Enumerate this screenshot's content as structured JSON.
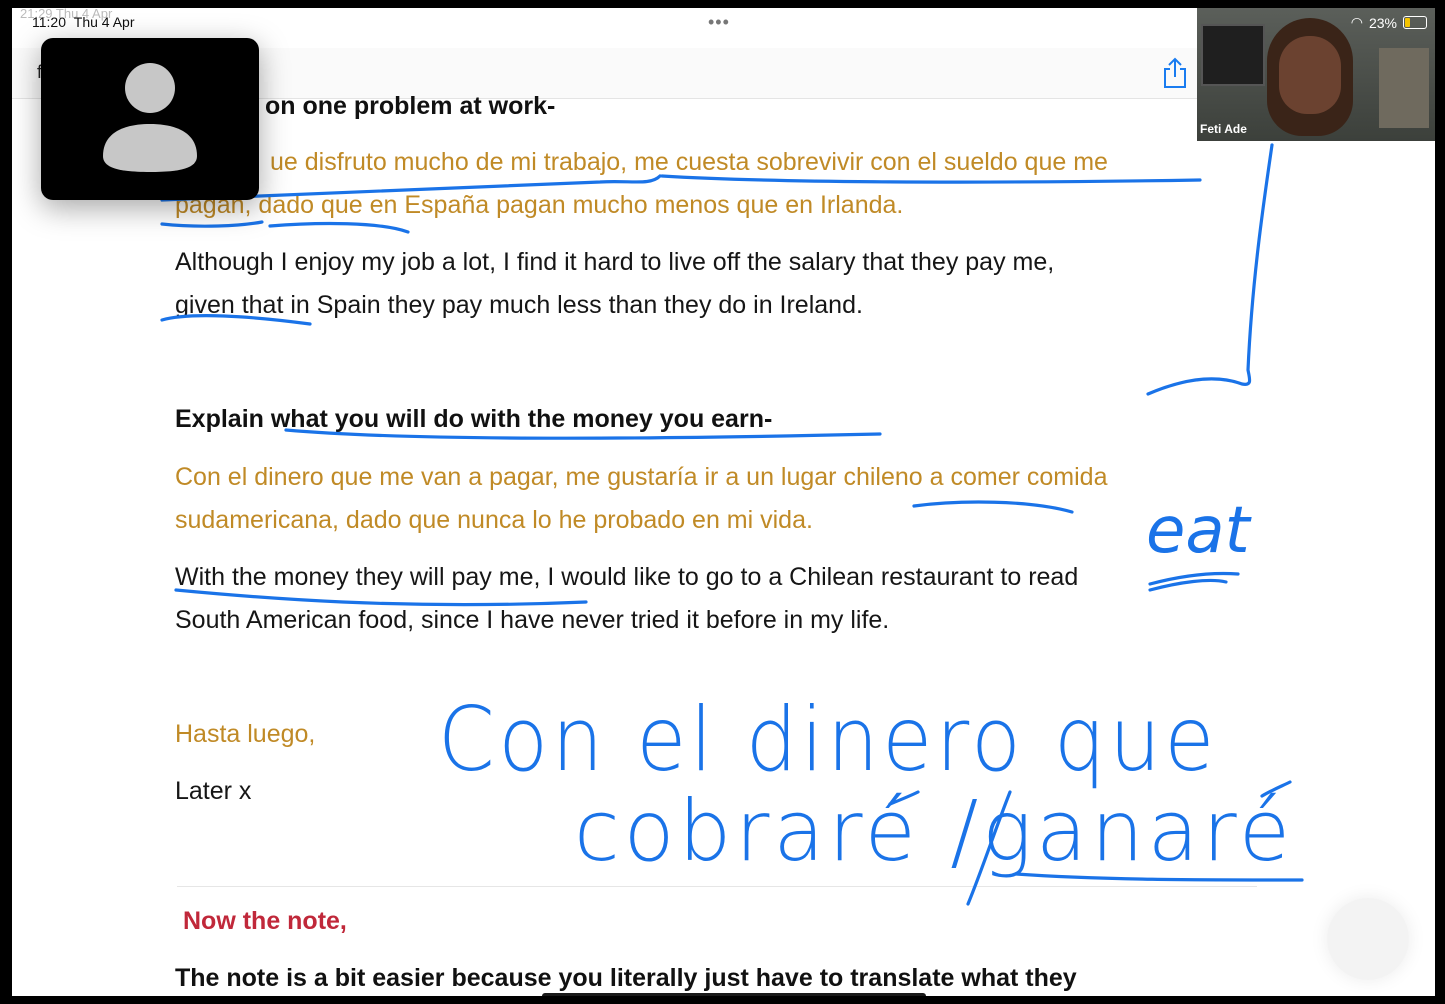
{
  "status_bar": {
    "time": "11:20",
    "date": "Thu 4 Apr",
    "ghost_time": "21:29  Thu 4 Apr",
    "battery": "23%"
  },
  "navbar": {
    "title_visible": "f"
  },
  "video_call": {
    "participant_name": "Feti Ade"
  },
  "document": {
    "heading_problem": "on one problem at work-",
    "problem_es_line1": "ue disfruto mucho de mi trabajo, me cuesta sobrevivir con el sueldo que me",
    "problem_es_line2": "pagan, dado que en España pagan mucho menos que en Irlanda.",
    "problem_en_line1": "Although I enjoy my job a lot, I find it hard to live off the salary that they pay me,",
    "problem_en_line2": "given that in Spain they pay much less than they do in Ireland.",
    "heading_money": "Explain what you will do with the money you earn-",
    "money_es_line1": "Con el dinero que me van a pagar, me gustaría ir a un lugar chileno a comer comida",
    "money_es_line2": "sudamericana, dado que nunca lo he probado en mi vida.",
    "money_en_line1": "With the money they will pay me, I would like to go to a Chilean restaurant to read",
    "money_en_line2": "South American food, since I have never tried it before in my life.",
    "closing_es": "Hasta luego,",
    "closing_en": "Later x",
    "note_label": "Now the note,",
    "note_text": "The note is a bit easier because you literally just have to translate what they"
  },
  "handwriting": {
    "eat": "eat",
    "line1": "Con el dinero que",
    "line2": "cobraré /ganaré"
  },
  "colors": {
    "spanish_text": "#c08a26",
    "ink": "#1a73e8",
    "note_label": "#c0283a"
  }
}
